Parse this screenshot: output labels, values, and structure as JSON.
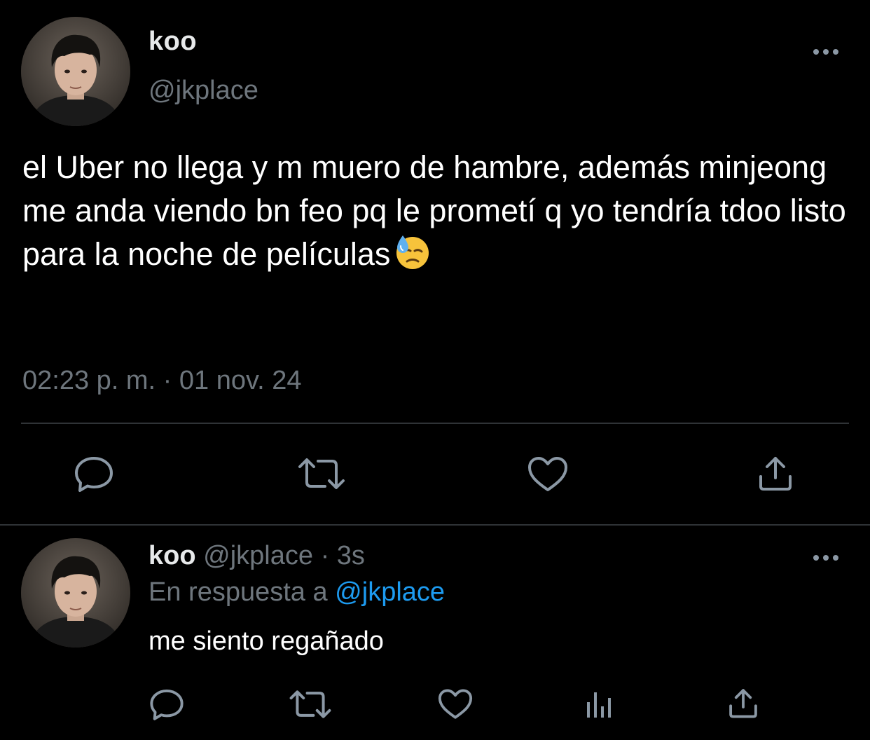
{
  "main_tweet": {
    "display_name": "koo",
    "handle": "@jkplace",
    "text": "el Uber no llega y m muero de hambre, además minjeong me anda viendo bn feo pq le prometí q yo tendría tdoo listo para la noche de películas",
    "emoji": "downcast-face-with-sweat",
    "timestamp": "02:23 p. m. · 01 nov. 24",
    "actions": [
      "reply-icon",
      "retweet-icon",
      "like-icon",
      "share-icon"
    ]
  },
  "reply_tweet": {
    "display_name": "koo",
    "handle": "@jkplace",
    "separator": "·",
    "time": "3s",
    "reply_context_prefix": "En respuesta a",
    "reply_context_handle": "@jkplace",
    "text": "me siento regañado",
    "actions": [
      "reply-icon",
      "retweet-icon",
      "like-icon",
      "analytics-icon",
      "share-icon"
    ]
  },
  "colors": {
    "background": "#000000",
    "primary_text": "#e7e9ea",
    "secondary_text": "#6e767d",
    "link": "#1d9bf0",
    "divider": "#2f3336",
    "icon": "#8b98a5"
  }
}
